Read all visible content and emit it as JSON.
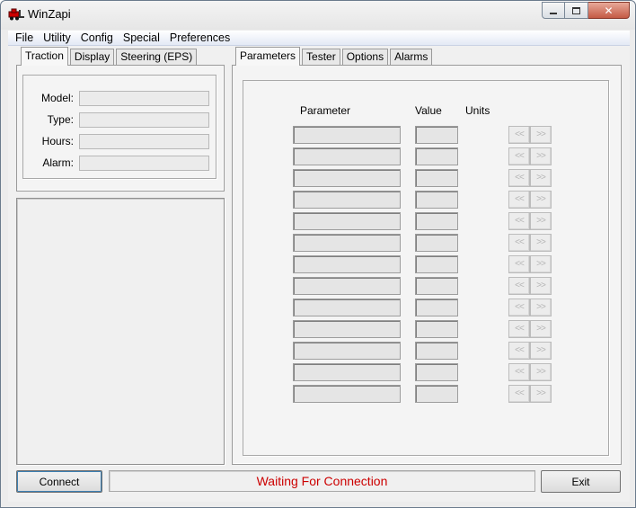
{
  "window": {
    "title": "WinZapi",
    "icon": "forklift-icon",
    "controls": {
      "minimize": "minimize-icon",
      "maximize": "maximize-icon",
      "close": "close-icon"
    }
  },
  "menu": [
    "File",
    "Utility",
    "Config",
    "Special",
    "Preferences"
  ],
  "left_tabs": [
    "Traction",
    "Display",
    "Steering (EPS)"
  ],
  "left_tab_active": "Traction",
  "info_fields": [
    {
      "label": "Model:",
      "value": ""
    },
    {
      "label": "Type:",
      "value": ""
    },
    {
      "label": "Hours:",
      "value": ""
    },
    {
      "label": "Alarm:",
      "value": ""
    }
  ],
  "right_tabs": [
    "Parameters",
    "Tester",
    "Options",
    "Alarms"
  ],
  "right_tab_active": "Parameters",
  "param_table": {
    "headers": {
      "parameter": "Parameter",
      "value": "Value",
      "units": "Units"
    },
    "row_count": 13,
    "rows": [
      {
        "parameter": "",
        "value": "",
        "units": ""
      },
      {
        "parameter": "",
        "value": "",
        "units": ""
      },
      {
        "parameter": "",
        "value": "",
        "units": ""
      },
      {
        "parameter": "",
        "value": "",
        "units": ""
      },
      {
        "parameter": "",
        "value": "",
        "units": ""
      },
      {
        "parameter": "",
        "value": "",
        "units": ""
      },
      {
        "parameter": "",
        "value": "",
        "units": ""
      },
      {
        "parameter": "",
        "value": "",
        "units": ""
      },
      {
        "parameter": "",
        "value": "",
        "units": ""
      },
      {
        "parameter": "",
        "value": "",
        "units": ""
      },
      {
        "parameter": "",
        "value": "",
        "units": ""
      },
      {
        "parameter": "",
        "value": "",
        "units": ""
      },
      {
        "parameter": "",
        "value": "",
        "units": ""
      }
    ],
    "decrease_label": "<<",
    "increase_label": ">>"
  },
  "buttons": {
    "connect": "Connect",
    "exit": "Exit"
  },
  "status": {
    "text": "Waiting For Connection",
    "color": "#cc0000"
  }
}
